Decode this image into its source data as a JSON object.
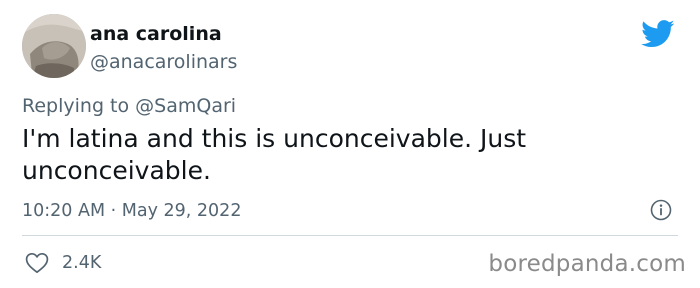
{
  "tweet": {
    "display_name": "ana carolina",
    "handle": "@anacarolinars",
    "replying_to_prefix": "Replying to ",
    "replying_to_handle": "@SamQari",
    "text": "I'm latina and this is unconceivable. Just unconceivable.",
    "time": "10:20 AM",
    "separator": " · ",
    "date": "May 29, 2022",
    "like_count": "2.4K"
  },
  "icons": {
    "brand": "twitter-bird-icon",
    "info": "info-icon",
    "like": "heart-icon"
  },
  "colors": {
    "twitter_blue": "#1d9bf0",
    "secondary_text": "#536471",
    "primary_text": "#0f1419",
    "divider": "#cfd9de",
    "watermark": "#8a8a8a"
  },
  "watermark": "boredpanda.com"
}
